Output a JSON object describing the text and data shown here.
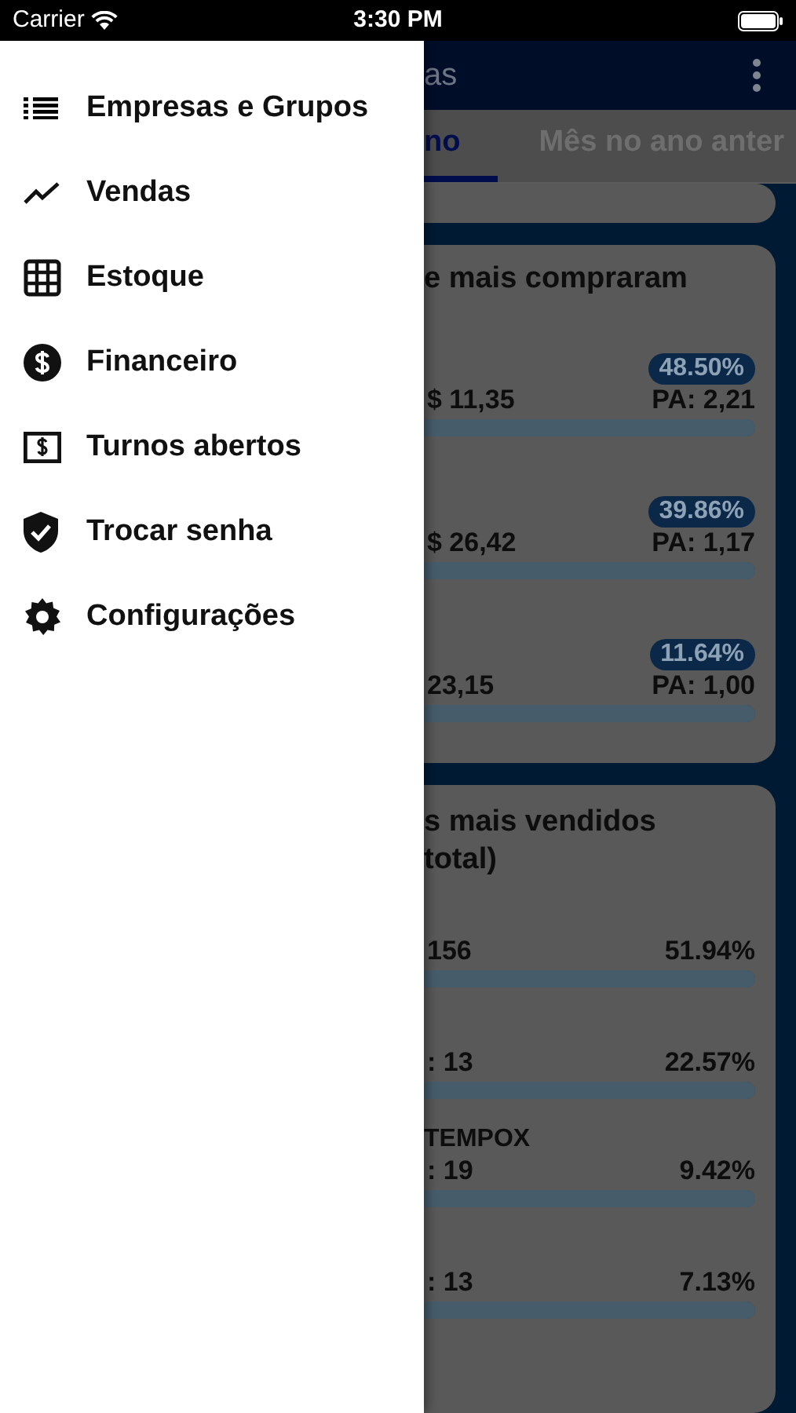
{
  "status_bar": {
    "carrier": "Carrier",
    "time": "3:30 PM"
  },
  "drawer": {
    "items": [
      {
        "label": "Empresas e Grupos",
        "kind": "list"
      },
      {
        "label": "Vendas",
        "kind": "trend"
      },
      {
        "label": "Estoque",
        "kind": "grid"
      },
      {
        "label": "Financeiro",
        "kind": "dollar"
      },
      {
        "label": "Turnos abertos",
        "kind": "cash"
      },
      {
        "label": "Trocar senha",
        "kind": "shield"
      },
      {
        "label": "Configurações",
        "kind": "gear"
      }
    ]
  },
  "header": {
    "title": "as"
  },
  "tabs": [
    {
      "label": "no",
      "selected": true
    },
    {
      "label": "Mês no ano anter",
      "selected": false
    }
  ],
  "cards": [
    {
      "kind": "fragment"
    },
    {
      "title_lines": [
        "e mais compraram"
      ],
      "rows": [
        {
          "badge": "48.50%",
          "value": "$ 11,35",
          "reading": "PA: 2,21",
          "level": 1
        },
        {
          "badge": "39.86%",
          "value": "$ 26,42",
          "reading": "PA: 1,17",
          "level": 1
        },
        {
          "badge": "11.64%",
          "value": "23,15",
          "reading": "PA: 1,00",
          "level": 1
        }
      ]
    },
    {
      "title_lines": [
        "s mais vendidos",
        "total)"
      ],
      "rows": [
        {
          "value": "156",
          "reading": "51.94%",
          "level": 1
        },
        {
          "value": ": 13",
          "reading": "22.57%",
          "level": 1
        },
        {
          "name": "TEMPOX",
          "value": ": 19",
          "reading": "9.42%",
          "level": 1
        },
        {
          "value": ": 13",
          "reading": "7.13%",
          "level": 1
        }
      ]
    }
  ]
}
